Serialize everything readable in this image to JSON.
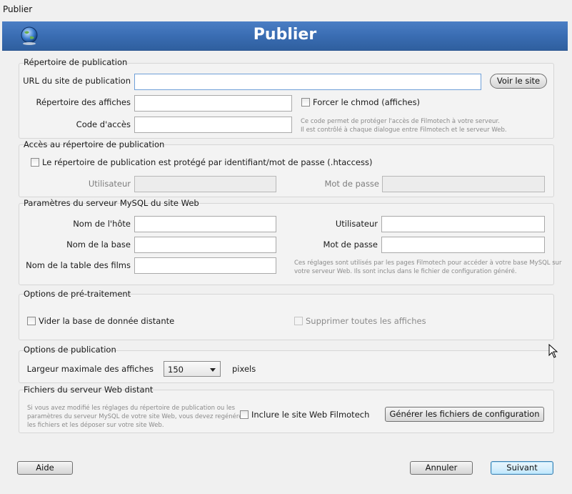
{
  "window": {
    "title": "Publier",
    "banner_title": "Publier",
    "icon": "globe-icon"
  },
  "repertoire": {
    "group_title": "Répertoire de publication",
    "url_label": "URL du site de publication",
    "url_value": "",
    "voir_button": "Voir le site",
    "affiches_label": "Répertoire des affiches",
    "affiches_value": "",
    "chmod_label": "Forcer le chmod (affiches)",
    "code_label": "Code d'accès",
    "code_value": "",
    "note1": "Ce code permet de protéger l'accès de Filmotech à votre serveur.",
    "note2": "Il est contrôlé à chaque dialogue entre Filmotech et le serveur Web."
  },
  "acces": {
    "group_title": "Accès au répertoire de publication",
    "protect_label": "Le répertoire de publication est protégé par identifiant/mot de passe (.htaccess)",
    "user_label": "Utilisateur",
    "pass_label": "Mot de passe"
  },
  "mysql": {
    "group_title": "Paramètres du serveur MySQL du site Web",
    "host_label": "Nom de l'hôte",
    "user_label": "Utilisateur",
    "db_label": "Nom de la base",
    "pass_label": "Mot de passe",
    "table_label": "Nom de la table des films",
    "note1": "Ces réglages sont utilisés par les pages Filmotech pour accéder à votre base MySQL sur",
    "note2": "votre serveur Web. Ils sont inclus dans le fichier de configuration généré."
  },
  "pretraitement": {
    "group_title": "Options de pré-traitement",
    "vider_label": "Vider la base de donnée distante",
    "supprimer_label": "Supprimer toutes les affiches"
  },
  "publication": {
    "group_title": "Options de publication",
    "largeur_label": "Largeur maximale des affiches",
    "largeur_value": "150",
    "unit": "pixels"
  },
  "fichiers": {
    "group_title": "Fichiers du serveur Web distant",
    "note1": "Si vous avez modifié les réglages du répertoire de publication ou les",
    "note2": "paramètres du serveur MySQL de votre site Web, vous devez regénérer",
    "note3": "les fichiers et les déposer sur votre site Web.",
    "inclure_label": "Inclure le site Web Filmotech",
    "generer_button": "Générer les fichiers de configuration"
  },
  "footer": {
    "aide": "Aide",
    "annuler": "Annuler",
    "suivant": "Suivant"
  }
}
